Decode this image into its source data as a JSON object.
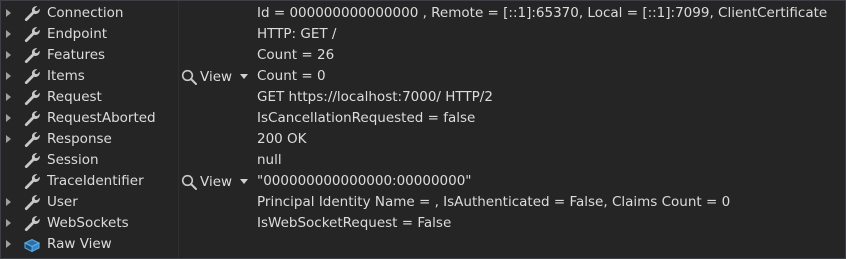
{
  "rows": [
    {
      "name": "Connection",
      "value": "Id = 000000000000000 , Remote = [::1]:65370, Local = [::1]:7099, ClientCertificate",
      "icon": "wrench-icon",
      "expandable": true,
      "viewer": false
    },
    {
      "name": "Endpoint",
      "value": "HTTP: GET /",
      "icon": "wrench-icon",
      "expandable": true,
      "viewer": false
    },
    {
      "name": "Features",
      "value": "Count = 26",
      "icon": "wrench-icon",
      "expandable": true,
      "viewer": false
    },
    {
      "name": "Items",
      "value": "Count = 0",
      "icon": "wrench-icon",
      "expandable": true,
      "viewer": true
    },
    {
      "name": "Request",
      "value": "GET https://localhost:7000/ HTTP/2",
      "icon": "wrench-icon",
      "expandable": true,
      "viewer": false
    },
    {
      "name": "RequestAborted",
      "value": "IsCancellationRequested = false",
      "icon": "wrench-icon",
      "expandable": true,
      "viewer": false
    },
    {
      "name": "Response",
      "value": "200 OK",
      "icon": "wrench-icon",
      "expandable": true,
      "viewer": false
    },
    {
      "name": "Session",
      "value": "null",
      "icon": "wrench-icon",
      "expandable": false,
      "viewer": false
    },
    {
      "name": "TraceIdentifier",
      "value": "\"000000000000000:00000000\"",
      "icon": "wrench-icon",
      "expandable": false,
      "viewer": true
    },
    {
      "name": "User",
      "value": "Principal Identity Name =           , IsAuthenticated = False, Claims Count = 0",
      "icon": "wrench-icon",
      "expandable": true,
      "viewer": false
    },
    {
      "name": "WebSockets",
      "value": "IsWebSocketRequest = False",
      "icon": "wrench-icon",
      "expandable": true,
      "viewer": false
    },
    {
      "name": "Raw View",
      "value": "",
      "icon": "raw-view-icon",
      "expandable": true,
      "viewer": false
    }
  ],
  "viewer_label": "View",
  "colors": {
    "background": "#252526",
    "text": "#dcdcdc",
    "icon": "#c8c8c8",
    "raw_view_icon": "#4fa0d8"
  }
}
